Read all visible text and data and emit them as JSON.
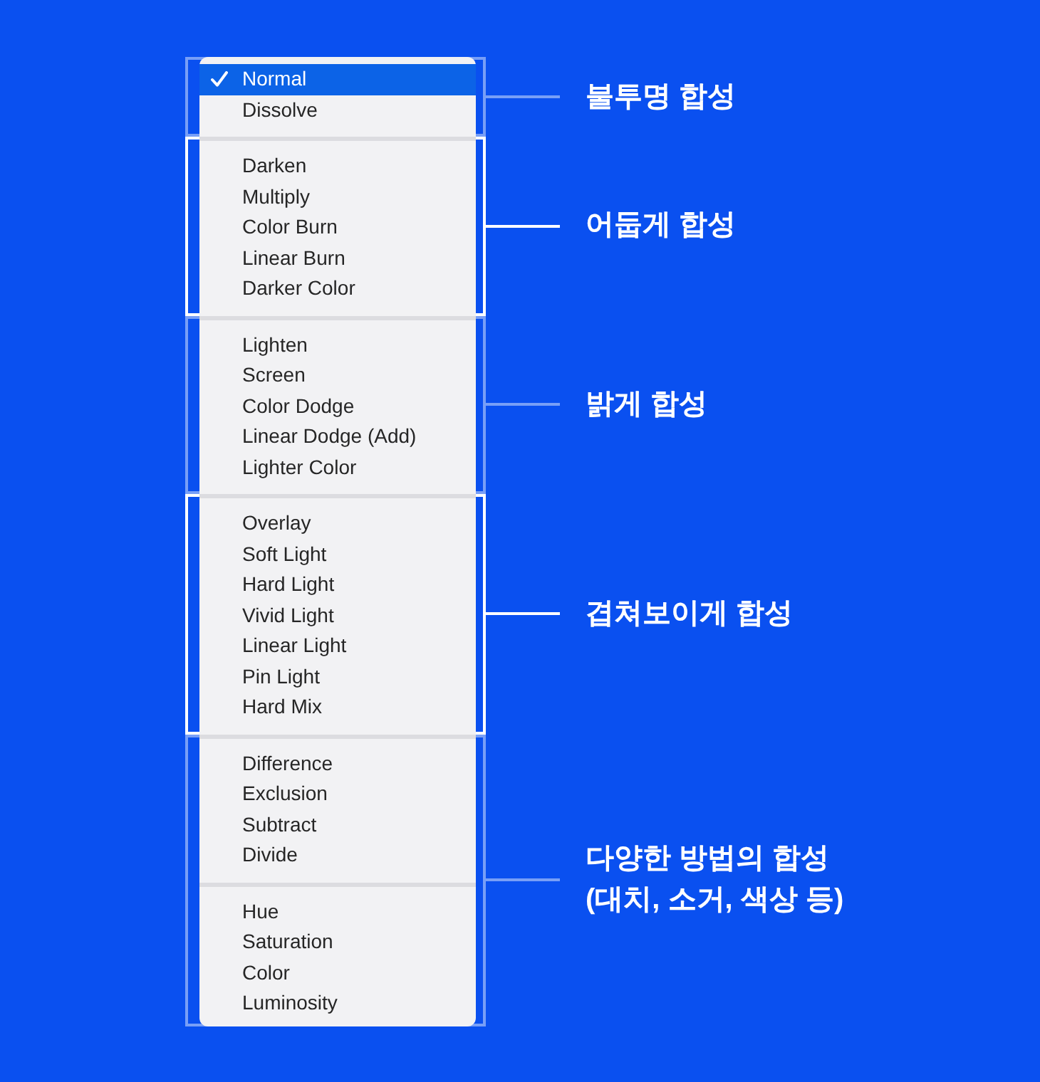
{
  "sections": [
    {
      "label": "불투명 합성",
      "highlighted": false,
      "groups": [
        {
          "items": [
            {
              "label": "Normal",
              "selected": true
            },
            {
              "label": "Dissolve",
              "selected": false
            }
          ]
        }
      ]
    },
    {
      "label": "어둡게 합성",
      "highlighted": true,
      "groups": [
        {
          "items": [
            {
              "label": "Darken",
              "selected": false
            },
            {
              "label": "Multiply",
              "selected": false
            },
            {
              "label": "Color Burn",
              "selected": false
            },
            {
              "label": "Linear Burn",
              "selected": false
            },
            {
              "label": "Darker Color",
              "selected": false
            }
          ]
        }
      ]
    },
    {
      "label": "밝게 합성",
      "highlighted": false,
      "groups": [
        {
          "items": [
            {
              "label": "Lighten",
              "selected": false
            },
            {
              "label": "Screen",
              "selected": false
            },
            {
              "label": "Color Dodge",
              "selected": false
            },
            {
              "label": "Linear Dodge (Add)",
              "selected": false
            },
            {
              "label": "Lighter Color",
              "selected": false
            }
          ]
        }
      ]
    },
    {
      "label": "겹쳐보이게 합성",
      "highlighted": true,
      "groups": [
        {
          "items": [
            {
              "label": "Overlay",
              "selected": false
            },
            {
              "label": "Soft Light",
              "selected": false
            },
            {
              "label": "Hard Light",
              "selected": false
            },
            {
              "label": "Vivid Light",
              "selected": false
            },
            {
              "label": "Linear Light",
              "selected": false
            },
            {
              "label": "Pin Light",
              "selected": false
            },
            {
              "label": "Hard Mix",
              "selected": false
            }
          ]
        }
      ]
    },
    {
      "label": "다양한 방법의 합성\n(대치, 소거, 색상 등)",
      "highlighted": false,
      "groups": [
        {
          "items": [
            {
              "label": "Difference",
              "selected": false
            },
            {
              "label": "Exclusion",
              "selected": false
            },
            {
              "label": "Subtract",
              "selected": false
            },
            {
              "label": "Divide",
              "selected": false
            }
          ]
        },
        {
          "items": [
            {
              "label": "Hue",
              "selected": false
            },
            {
              "label": "Saturation",
              "selected": false
            },
            {
              "label": "Color",
              "selected": false
            },
            {
              "label": "Luminosity",
              "selected": false
            }
          ]
        }
      ]
    }
  ]
}
